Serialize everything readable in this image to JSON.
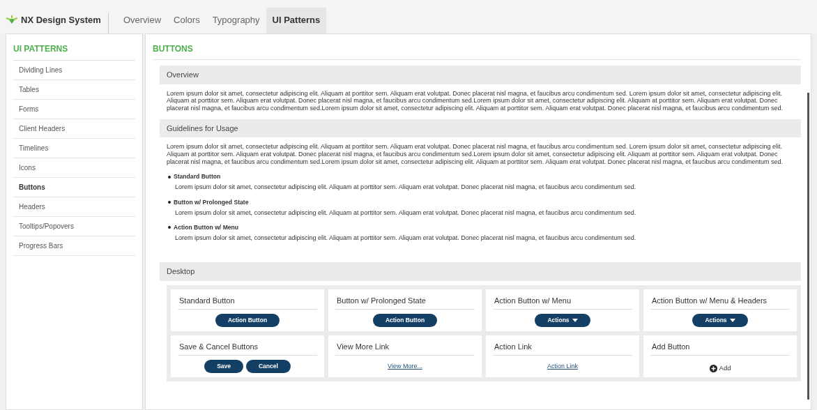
{
  "brand": {
    "name": "NX Design System"
  },
  "nav": [
    {
      "label": "Overview",
      "selected": false
    },
    {
      "label": "Colors",
      "selected": false
    },
    {
      "label": "Typography",
      "selected": false
    },
    {
      "label": "UI Patterns",
      "selected": true
    }
  ],
  "sidebar": {
    "title": "UI PATTERNS",
    "items": [
      {
        "label": "Dividing Lines",
        "selected": false
      },
      {
        "label": "Tables",
        "selected": false
      },
      {
        "label": "Forms",
        "selected": false
      },
      {
        "label": "Client Headers",
        "selected": false
      },
      {
        "label": "Timelines",
        "selected": false
      },
      {
        "label": "Icons",
        "selected": false
      },
      {
        "label": "Buttons",
        "selected": true
      },
      {
        "label": "Headers",
        "selected": false
      },
      {
        "label": "Tooltips/Popovers",
        "selected": false
      },
      {
        "label": "Progress Bars",
        "selected": false
      }
    ]
  },
  "page_title": "BUTTONS",
  "sections": [
    {
      "heading": "Overview",
      "text": "Lorem ipsum dolor sit amet, consectetur adipiscing elit. Aliquam at porttitor sem.  Aliquam erat volutpat. Donec placerat nisl magna, et faucibus arcu condimentum sed. Lorem ipsum dolor sit amet, consectetur adipiscing elit. Aliquam at porttitor sem.  Aliquam erat volutpat. Donec placerat nisl magna, et faucibus arcu condimentum sed.Lorem ipsum dolor sit amet, consectetur adipiscing elit. Aliquam at porttitor sem.  Aliquam erat volutpat. Donec placerat nisl magna, et faucibus arcu condimentum sed.Lorem ipsum dolor sit amet, consectetur adipiscing elit. Aliquam at porttitor sem.  Aliquam erat volutpat. Donec placerat nisl magna, et faucibus arcu condimentum sed."
    },
    {
      "heading": "Guidelines for Usage",
      "text": "Lorem ipsum dolor sit amet, consectetur adipiscing elit. Aliquam at porttitor sem.  Aliquam erat volutpat. Donec placerat nisl magna, et faucibus arcu condimentum sed. Lorem ipsum dolor sit amet, consectetur adipiscing elit. Aliquam at porttitor sem.  Aliquam erat volutpat. Donec placerat nisl magna, et faucibus arcu condimentum sed.Lorem ipsum dolor sit amet, consectetur adipiscing elit. Aliquam at porttitor sem.  Aliquam erat volutpat. Donec placerat nisl magna, et faucibus arcu condimentum sed.Lorem ipsum dolor sit amet, consectetur adipiscing elit. Aliquam at porttitor sem.  Aliquam erat volutpat. Donec placerat nisl magna, et faucibus arcu condimentum sed.",
      "bullets": [
        {
          "title": "Standard Button",
          "text": "Lorem ipsum dolor sit amet, consectetur adipiscing elit. Aliquam at porttitor sem.  Aliquam erat volutpat. Donec placerat nisl magna, et faucibus arcu condimentum sed."
        },
        {
          "title": "Button w/ Prolonged State",
          "text": "Lorem ipsum dolor sit amet, consectetur adipiscing elit. Aliquam at porttitor sem.  Aliquam erat volutpat. Donec placerat nisl magna, et faucibus arcu condimentum sed."
        },
        {
          "title": "Action Button w/ Menu",
          "text": "Lorem ipsum dolor sit amet, consectetur adipiscing elit. Aliquam at porttitor sem.  Aliquam erat volutpat. Donec placerat nisl magna, et faucibus arcu condimentum sed."
        }
      ]
    },
    {
      "heading": "Desktop",
      "examples": [
        {
          "title": "Standard Button",
          "kind": "button",
          "labels": [
            "Action Button"
          ]
        },
        {
          "title": "Button w/ Prolonged State",
          "kind": "button",
          "labels": [
            "Action Button"
          ]
        },
        {
          "title": "Action Button w/ Menu",
          "kind": "dropdown",
          "labels": [
            "Actions"
          ]
        },
        {
          "title": "Action Button w/ Menu & Headers",
          "kind": "dropdown",
          "labels": [
            "Actions"
          ]
        },
        {
          "title": "Save & Cancel Buttons",
          "kind": "button",
          "labels": [
            "Save",
            "Cancel"
          ]
        },
        {
          "title": "View More Link",
          "kind": "link",
          "labels": [
            "View More..."
          ]
        },
        {
          "title": "Action Link",
          "kind": "link",
          "labels": [
            "Action Link"
          ]
        },
        {
          "title": "Add Button",
          "kind": "add",
          "labels": [
            "Add"
          ]
        }
      ]
    }
  ]
}
